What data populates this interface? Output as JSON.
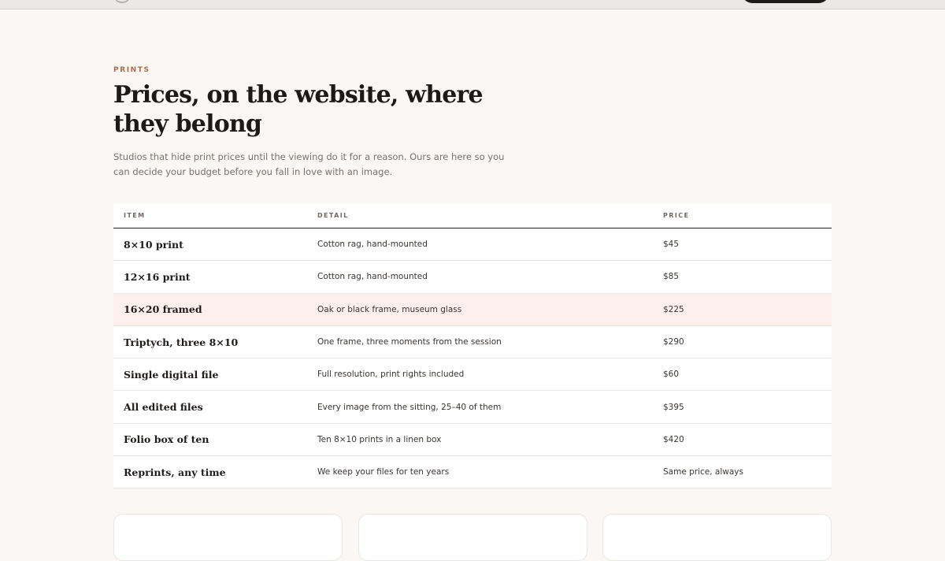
{
  "section": {
    "eyebrow": "PRINTS",
    "title": "Prices, on the website, where they belong",
    "lede": "Studios that hide print prices until the viewing do it for a reason. Ours are here so you can decide your budget before you fall in love with an image."
  },
  "table": {
    "headers": [
      "ITEM",
      "DETAIL",
      "PRICE"
    ],
    "rows": [
      {
        "item": "8×10 print",
        "detail": "Cotton rag, hand-mounted",
        "price": "$45"
      },
      {
        "item": "12×16 print",
        "detail": "Cotton rag, hand-mounted",
        "price": "$85"
      },
      {
        "item": "16×20 framed",
        "detail": "Oak or black frame, museum glass",
        "price": "$225"
      },
      {
        "item": "Triptych, three 8×10",
        "detail": "One frame, three moments from the session",
        "price": "$290"
      },
      {
        "item": "Single digital file",
        "detail": "Full resolution, print rights included",
        "price": "$60"
      },
      {
        "item": "All edited files",
        "detail": "Every image from the sitting, 25–40 of them",
        "price": "$395"
      },
      {
        "item": "Folio box of ten",
        "detail": "Ten 8×10 prints in a linen box",
        "price": "$420"
      },
      {
        "item": "Reprints, any time",
        "detail": "We keep your files for ten years",
        "price": "Same price, always"
      }
    ]
  },
  "colors": {
    "accent": "#b06a48",
    "highlight_row": "#fdf0ec",
    "background": "#faf7f4"
  }
}
